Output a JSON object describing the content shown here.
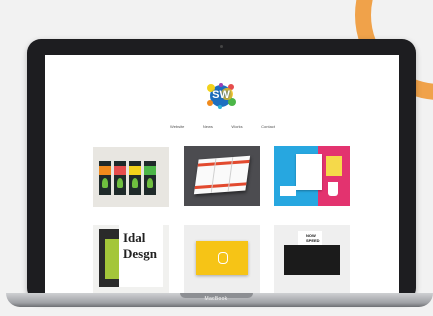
{
  "site": {
    "logo_text": "SW",
    "nav": [
      "Website",
      "News",
      "Works",
      "Contact"
    ]
  },
  "laptop": {
    "brand": "MacBook"
  },
  "thumbnails": {
    "typography_lines": [
      "Idal",
      "Desgn"
    ],
    "black_card_lines": [
      "NOW",
      "SPEED"
    ]
  },
  "colors": {
    "accent_arc": "#f0a24a",
    "laptop_frame": "#1d1d20",
    "screen_bg": "#ffffff"
  }
}
